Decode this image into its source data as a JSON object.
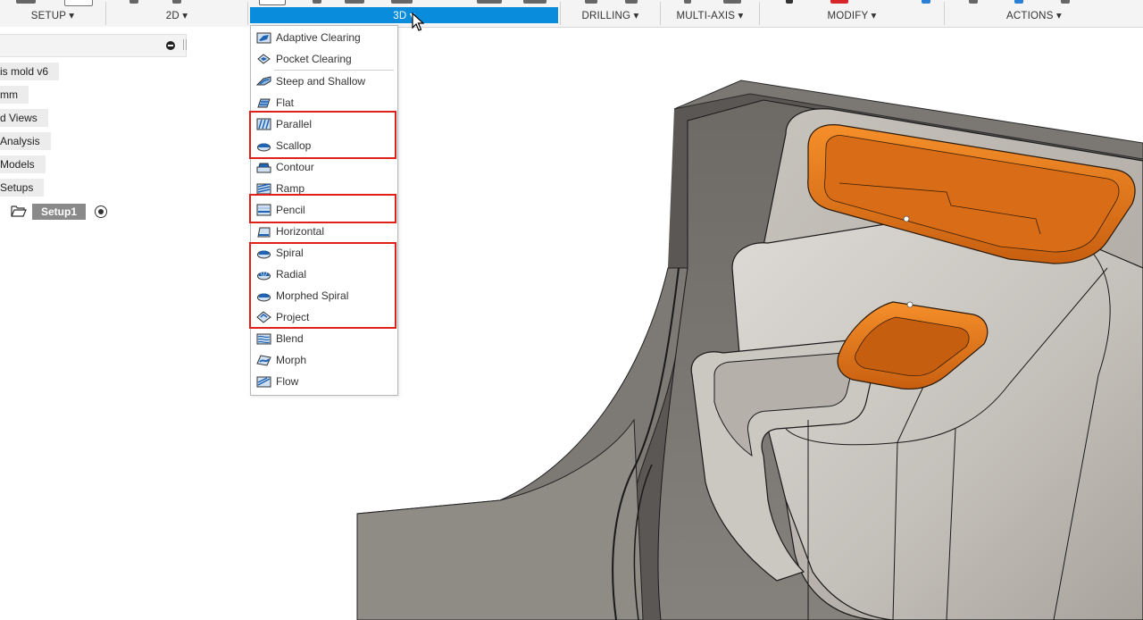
{
  "toolbar": {
    "groups": [
      {
        "label": "SETUP ▾"
      },
      {
        "label": "2D ▾"
      },
      {
        "label": "3D ▾"
      },
      {
        "label": "DRILLING ▾"
      },
      {
        "label": "MULTI-AXIS ▾"
      },
      {
        "label": "MODIFY ▾"
      },
      {
        "label": "ACTIONS ▾"
      }
    ],
    "active_group": "3D"
  },
  "browser": {
    "items": [
      {
        "label": "is mold v6"
      },
      {
        "label": "mm"
      },
      {
        "label": "d Views"
      },
      {
        "label": "Analysis"
      },
      {
        "label": "Models"
      },
      {
        "label": "Setups"
      }
    ],
    "setup_name": "Setup1"
  },
  "menu": {
    "items": [
      {
        "label": "Adaptive Clearing",
        "icon": "adaptive-clearing-icon"
      },
      {
        "label": "Pocket Clearing",
        "icon": "pocket-clearing-icon"
      },
      {
        "label": "Steep and Shallow",
        "icon": "steep-shallow-icon"
      },
      {
        "label": "Flat",
        "icon": "flat-icon"
      },
      {
        "label": "Parallel",
        "icon": "parallel-icon"
      },
      {
        "label": "Scallop",
        "icon": "scallop-icon"
      },
      {
        "label": "Contour",
        "icon": "contour-icon"
      },
      {
        "label": "Ramp",
        "icon": "ramp-icon"
      },
      {
        "label": "Pencil",
        "icon": "pencil-icon"
      },
      {
        "label": "Horizontal",
        "icon": "horizontal-icon"
      },
      {
        "label": "Spiral",
        "icon": "spiral-icon"
      },
      {
        "label": "Radial",
        "icon": "radial-icon"
      },
      {
        "label": "Morphed Spiral",
        "icon": "morphed-spiral-icon"
      },
      {
        "label": "Project",
        "icon": "project-icon"
      },
      {
        "label": "Blend",
        "icon": "blend-icon"
      },
      {
        "label": "Morph",
        "icon": "morph-icon"
      },
      {
        "label": "Flow",
        "icon": "flow-icon"
      }
    ],
    "highlighted_groups": [
      [
        "Parallel",
        "Scallop"
      ],
      [
        "Pencil"
      ],
      [
        "Spiral",
        "Radial",
        "Morphed Spiral",
        "Project"
      ]
    ]
  },
  "colors": {
    "accent": "#0a8cdc",
    "highlight_box": "#e0201b",
    "model_body": "#a7a29b",
    "pocket_orange": "#e8761e"
  }
}
